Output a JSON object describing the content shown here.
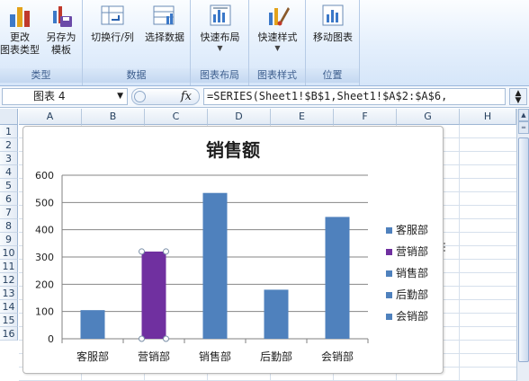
{
  "ribbon": {
    "groups": [
      {
        "label": "类型",
        "buttons": [
          {
            "label": "更改\n图表类型"
          },
          {
            "label": "另存为\n模板"
          }
        ]
      },
      {
        "label": "数据",
        "buttons": [
          {
            "label": "切换行/列"
          },
          {
            "label": "选择数据"
          }
        ]
      },
      {
        "label": "图表布局",
        "buttons": [
          {
            "label": "快速布局"
          }
        ]
      },
      {
        "label": "图表样式",
        "buttons": [
          {
            "label": "快速样式"
          }
        ]
      },
      {
        "label": "位置",
        "buttons": [
          {
            "label": "移动图表"
          }
        ]
      }
    ]
  },
  "formula_bar": {
    "name_box": "图表 4",
    "fx_label": "fx",
    "formula": "=SERIES(Sheet1!$B$1,Sheet1!$A$2:$A$6,"
  },
  "grid": {
    "columns": [
      "A",
      "B",
      "C",
      "D",
      "E",
      "F",
      "G",
      "H"
    ],
    "rows": [
      "1",
      "2",
      "3",
      "4",
      "5",
      "6",
      "7",
      "8",
      "9",
      "10",
      "11",
      "12",
      "13",
      "14",
      "15",
      "16"
    ]
  },
  "chart_data": {
    "type": "bar",
    "title": "销售额",
    "categories": [
      "客服部",
      "营销部",
      "销售部",
      "后勤部",
      "会销部"
    ],
    "values": [
      105,
      320,
      535,
      180,
      447
    ],
    "ylim": [
      0,
      600
    ],
    "yticks": [
      0,
      100,
      200,
      300,
      400,
      500,
      600
    ],
    "grid": true,
    "legend_position": "right",
    "bar_color": "#4f81bd",
    "selected_point_color": "#7030a0",
    "selected_index": 1,
    "legend": [
      "客服部",
      "营销部",
      "销售部",
      "后勤部",
      "会销部"
    ]
  }
}
